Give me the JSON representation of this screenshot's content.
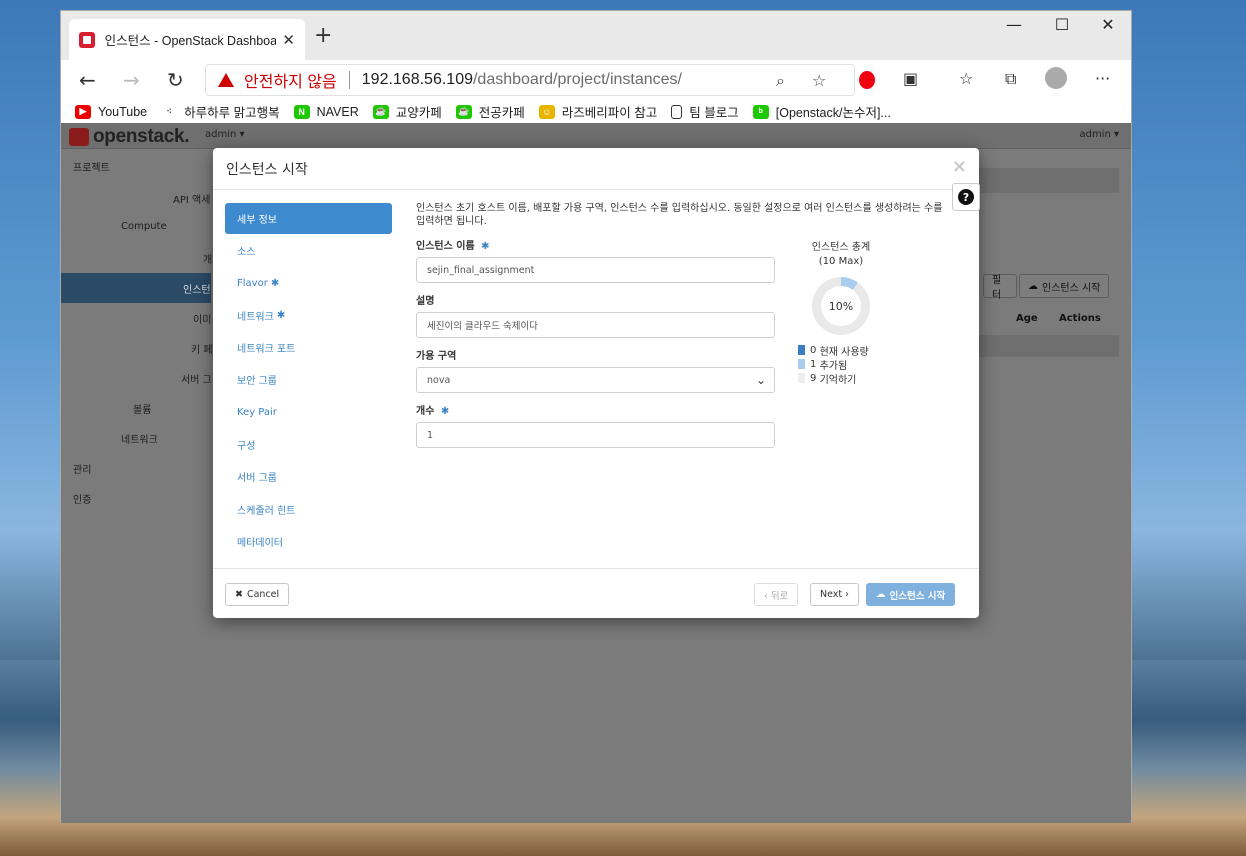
{
  "browser": {
    "tab_title": "인스턴스 - OpenStack Dashboard",
    "warning_text": "안전하지 않음",
    "url_host": "192.168.56.109",
    "url_path": "/dashboard/project/instances/",
    "bookmarks": [
      "YouTube",
      "하루하루 맑고행복",
      "NAVER",
      "교양카페",
      "전공카페",
      "라즈베리파이 참고",
      "팀 블로그",
      "[Openstack/논수저]..."
    ]
  },
  "openstack": {
    "logo": "openstack.",
    "project_menu": "admin ▾",
    "user_menu": "admin ▾",
    "sidebar": [
      "프로젝트",
      "API 액세",
      "Compute",
      "개",
      "인스턴",
      "이미",
      "키 페",
      "서버 그",
      "볼륨",
      "네트워크",
      "관리",
      "인증"
    ],
    "filter_button": "필터",
    "launch_button": "인스턴스 시작",
    "col_age": "Age",
    "col_actions": "Actions"
  },
  "modal": {
    "title": "인스턴스 시작",
    "close": "×",
    "nav": [
      {
        "label": "세부 정보",
        "required": false
      },
      {
        "label": "소스",
        "required": false
      },
      {
        "label": "Flavor",
        "required": true
      },
      {
        "label": "네트워크",
        "required": true
      },
      {
        "label": "네트워크 포트",
        "required": false
      },
      {
        "label": "보안 그룹",
        "required": false
      },
      {
        "label": "Key Pair",
        "required": false
      },
      {
        "label": "구성",
        "required": false
      },
      {
        "label": "서버 그룹",
        "required": false
      },
      {
        "label": "스케줄러 힌트",
        "required": false
      },
      {
        "label": "메타데이터",
        "required": false
      }
    ],
    "description": "인스턴스 초기 호스트 이름, 배포할 가용 구역, 인스턴스 수를 입력하십시오. 동일한 설정으로 여러 인스턴스를 생성하려는 수를 입력하면 됩니다.",
    "fields": {
      "name_label": "인스턴스 이름",
      "name_value": "sejin_final_assignment",
      "desc_label": "설명",
      "desc_value": "세진이의 클라우드 숙제이다",
      "zone_label": "가용 구역",
      "zone_value": "nova",
      "count_label": "개수",
      "count_value": "1"
    },
    "quota": {
      "title": "인스턴스 총계",
      "max": "(10 Max)",
      "percent": "10%",
      "percent_value": 0.1,
      "legend": [
        {
          "count": "0",
          "label": "현재 사용량",
          "color": "#3d7ec3"
        },
        {
          "count": "1",
          "label": "추가됨",
          "color": "#a9cdee"
        },
        {
          "count": "9",
          "label": "기억하기",
          "color": "#eeeeee"
        }
      ]
    },
    "footer": {
      "cancel": "Cancel",
      "back": "‹ 뒤로",
      "next": "Next ›",
      "launch": "인스턴스 시작"
    }
  }
}
